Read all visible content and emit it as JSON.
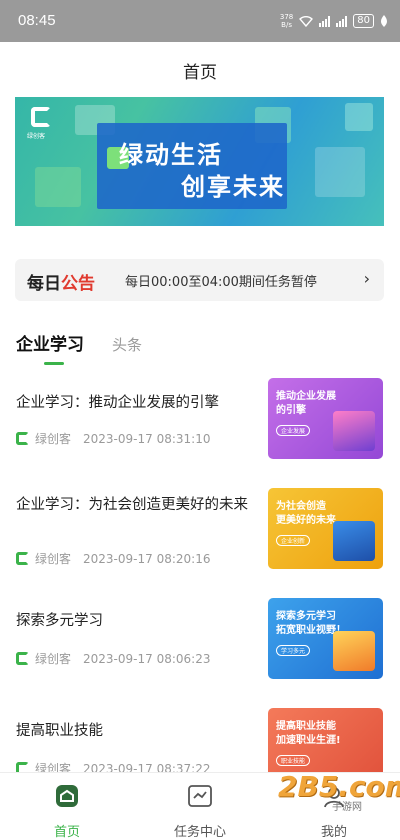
{
  "status_bar": {
    "time": "08:45",
    "speed_top": "378",
    "speed_bottom": "B/s",
    "battery": "80"
  },
  "page_title": "首页",
  "banner": {
    "line1": "绿动生活",
    "line2": "创享未来",
    "logo_text": "绿创客"
  },
  "notice": {
    "badge_main": "每日",
    "badge_accent": "公告",
    "text": "每日00:00至04:00期间任务暂停",
    "chevron": "›"
  },
  "tabs": [
    {
      "label": "企业学习",
      "active": true
    },
    {
      "label": "头条",
      "active": false
    }
  ],
  "articles": [
    {
      "title": "企业学习：推动企业发展的引擎",
      "source": "绿创客",
      "date": "2023-09-17 08:31:10",
      "thumb_text": "推动企业发展\n的引擎",
      "thumb_tag": "企业发展",
      "thumb_color": "#b65ee0"
    },
    {
      "title": "企业学习：为社会创造更美好的未来",
      "source": "绿创客",
      "date": "2023-09-17 08:20:16",
      "thumb_text": "为社会创造\n更美好的未来",
      "thumb_tag": "企业创新",
      "thumb_color": "#f2b41e"
    },
    {
      "title": "探索多元学习",
      "source": "绿创客",
      "date": "2023-09-17 08:06:23",
      "thumb_text": "探索多元学习\n拓宽职业视野！",
      "thumb_tag": "学习多元",
      "thumb_color": "#2f8fe0"
    },
    {
      "title": "提高职业技能",
      "source": "绿创客",
      "date": "2023-09-17 08:37:22",
      "thumb_text": "提高职业技能\n加速职业生涯!",
      "thumb_tag": "职业技能",
      "thumb_color": "#ef6a4d"
    }
  ],
  "bottom_nav": [
    {
      "label": "首页",
      "icon": "home-icon",
      "active": true
    },
    {
      "label": "任务中心",
      "icon": "task-icon",
      "active": false
    },
    {
      "label": "我的",
      "icon": "profile-icon",
      "active": false
    }
  ],
  "watermark": {
    "text": "2B5.com",
    "sub": "手游网"
  },
  "colors": {
    "accent": "#3bb34a",
    "notice_red": "#e03a2f"
  }
}
